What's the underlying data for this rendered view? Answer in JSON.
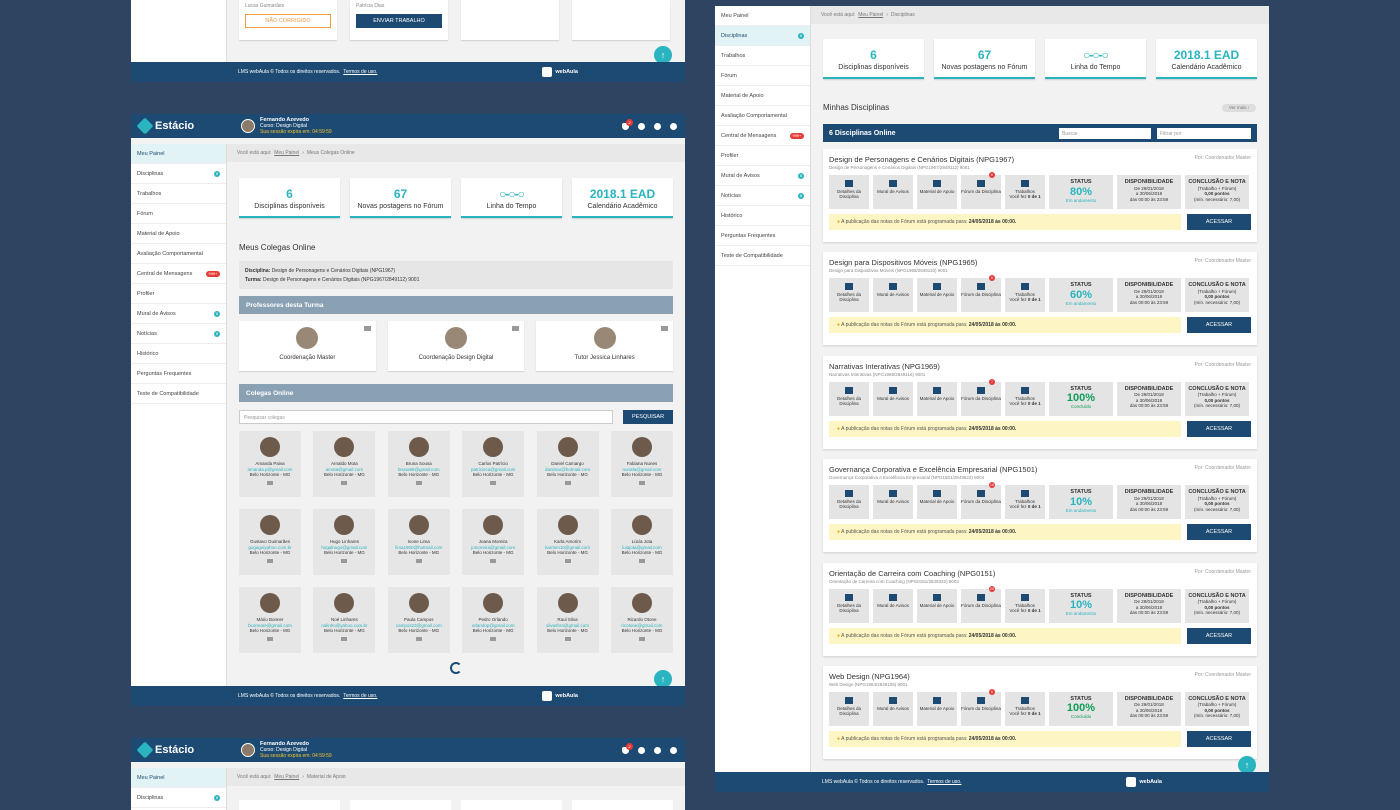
{
  "header": {
    "brand": "Estácio",
    "user_name": "Fernando Azevedo",
    "course": "Curso: Design Digital",
    "session": "Sua sessão expira em: 04:59:59",
    "notif_count": "2"
  },
  "sidebar": [
    {
      "label": "Meu Painel"
    },
    {
      "label": "Disciplinas",
      "badge": "6"
    },
    {
      "label": "Trabalhos"
    },
    {
      "label": "Fórum"
    },
    {
      "label": "Material de Apoio"
    },
    {
      "label": "Avaliação Comportamental"
    },
    {
      "label": "Central de Mensagens",
      "badge": "999+"
    },
    {
      "label": "Profiler"
    },
    {
      "label": "Mural de Avisos",
      "badge": "6"
    },
    {
      "label": "Notícias",
      "badge": "6"
    },
    {
      "label": "Histórico"
    },
    {
      "label": "Perguntas Frequentes"
    },
    {
      "label": "Teste de Compatibilidade"
    }
  ],
  "stats": [
    {
      "value": "6",
      "label": "Disciplinas disponíveis"
    },
    {
      "value": "67",
      "label": "Novas postagens no Fórum"
    },
    {
      "value": "",
      "label": "Linha do Tempo"
    },
    {
      "value": "2018.1 EAD",
      "label": "Calendário Acadêmico"
    }
  ],
  "footer": {
    "text": "LMS webAula © Todos os direitos reservados.",
    "terms": "Termos de uso.",
    "brand": "webAula"
  },
  "top_fragment": {
    "name1": "Lucas Guimarães",
    "name2": "Patrícia Dias",
    "btn1": "NÃO CORRIGIDO",
    "btn2": "ENVIAR TRABALHO"
  },
  "colegas_page": {
    "crumb_here": "Você está aqui:",
    "crumb_home": "Meu Painel",
    "crumb_current": "Meus Colegas Online",
    "title": "Meus Colegas Online",
    "disciplina_label": "Disciplina:",
    "disciplina": "Design de Personagens e Cenários Digitais (NPG1967)",
    "turma_label": "Turma:",
    "turma": "Design de Personagens e Cenários Digitais (NPG1967/2849112) 9001",
    "profs_title": "Professores desta Turma",
    "profs": [
      "Coordenação Master",
      "Coordenação Design Digital",
      "Tutor Jessica Linhares"
    ],
    "online_title": "Colegas Online",
    "search_placeholder": "Pesquisar colegas",
    "search_btn": "PESQUISAR",
    "colegas": [
      {
        "name": "Amanda Paiva",
        "email": "amanda.p@gmail.com",
        "city": "Belo Horizonte - MG"
      },
      {
        "name": "Arnaldo Mota",
        "email": "amota@gmail.com",
        "city": "Belo Horizonte - MG"
      },
      {
        "name": "Bruna Sousa",
        "email": "bruna88@gmail.com",
        "city": "Belo Horizonte - MG"
      },
      {
        "name": "Carlos Patrício",
        "email": "patricioca@gmail.com",
        "city": "Belo Horizonte - MG"
      },
      {
        "name": "Daniel Camargo",
        "email": "danimar@hotmail.com",
        "city": "Belo Horizonte - MG"
      },
      {
        "name": "Fabiana Nunes",
        "email": "nunafa@gmail.com",
        "city": "Belo Horizonte - MG"
      },
      {
        "name": "Gustavo Guimarães",
        "email": "gugaguiyahoo.com.br",
        "city": "Belo Horizonte - MG"
      },
      {
        "name": "Hugo Linhares",
        "email": "hugalnugo@gmail.com",
        "city": "Belo Horizonte - MG"
      },
      {
        "name": "Ivone Lima",
        "email": "lima1900@hotmail.com",
        "city": "Belo Horizonte - MG"
      },
      {
        "name": "Joana Moreira",
        "email": "jomoreira@gmail.com",
        "city": "Belo Horizonte - MG"
      },
      {
        "name": "Karla Amorim",
        "email": "karmim10@gmail.com",
        "city": "Belo Horizonte - MG"
      },
      {
        "name": "Lúcia Jota",
        "email": "luiajota@gmail.com",
        "city": "Belo Horizonte - MG"
      },
      {
        "name": "Mário Bonner",
        "email": "bconnare@gmail.com",
        "city": "Belo Horizonte - MG"
      },
      {
        "name": "Noé Linhares",
        "email": "nalinho@yahoo.com.br",
        "city": "Belo Horizonte - MG"
      },
      {
        "name": "Paula Campos",
        "email": "campos23@gmail.com",
        "city": "Belo Horizonte - MG"
      },
      {
        "name": "Pedro Orlando",
        "email": "orlandop@gmail.com",
        "city": "Belo Horizonte - MG"
      },
      {
        "name": "Raul Silva",
        "email": "silvashra@gmail.com",
        "city": "Belo Horizonte - MG"
      },
      {
        "name": "Ricardo Otone",
        "email": "ricotone@gmail.com",
        "city": "Belo Horizonte - MG"
      }
    ]
  },
  "material_page": {
    "crumb_here": "Você está aqui:",
    "crumb_home": "Meu Painel",
    "crumb_current": "Material de Apoio"
  },
  "disciplinas_page": {
    "crumb_here": "Você está aqui:",
    "crumb_home": "Meu Painel",
    "crumb_current": "Disciplinas",
    "title": "Minhas Disciplinas",
    "ver_mais": "Ver mais",
    "online_title": "6 Disciplinas Online",
    "buscar": "Buscar",
    "filtrar": "Filtrar por",
    "labels": {
      "detalhes": "Detalhes da Disciplina",
      "mural": "Mural de Avisos",
      "material": "Material de Apoio",
      "forum": "Fórum da Disciplina",
      "trabalhos": "Trabalhos",
      "voce_fez": "Você fez",
      "zero_de_um": "0 de 1",
      "status": "STATUS",
      "disponibilidade": "DISPONIBILIDADE",
      "de": "De 29/01/2018",
      "ate": "a 30/06/2018",
      "horas": "das 00:00 às 23:59",
      "conclusao": "CONCLUSÃO E NOTA",
      "trab_forum": "(Trabalho + Fórum)",
      "pontos": "0,00 pontos",
      "min": "(mín. necessário: 7,00)",
      "notice": "A publicação das notas do Fórum está programada para:",
      "notice_date": "24/05/2018 às 00:00.",
      "acessar": "ACESSAR",
      "por": "Por: Coordenador Master"
    },
    "disciplinas": [
      {
        "title": "Design de Personagens e Cenários Digitais (NPG1967)",
        "sub": "Design de Personagens e Cenários Digitais (NPG1967/2849112) 9001",
        "forum_badge": "6",
        "pct": "80%",
        "status": "Em andamento",
        "done": false
      },
      {
        "title": "Design para Dispositivos Móveis (NPG1965)",
        "sub": "Design para Dispositivos Móveis (NPG1965/2849110) 9001",
        "forum_badge": "6",
        "pct": "60%",
        "status": "Em andamento",
        "done": false
      },
      {
        "title": "Narrativas Interativas (NPG1969)",
        "sub": "Narrativas Interativas (NPG1969/2849116) 9001",
        "forum_badge": "7",
        "pct": "100%",
        "status": "Concluído",
        "done": true
      },
      {
        "title": "Governança Corporativa e Excelência Empresarial (NPG1501)",
        "sub": "Governança Corporativa e Excelência Empresarial (NPG1501/2849622) 9004",
        "forum_badge": "16",
        "pct": "10%",
        "status": "Em andamento",
        "done": false
      },
      {
        "title": "Orientação de Carreira com Coaching (NPG0151)",
        "sub": "Orientação de Carreira com Coaching (NPG0151/2849332) 9003",
        "forum_badge": "20",
        "pct": "10%",
        "status": "Em andamento",
        "done": false
      },
      {
        "title": "Web Design (NPG1964)",
        "sub": "Web Design (NPG1964/2849105) 9001",
        "forum_badge": "6",
        "pct": "100%",
        "status": "Concluído",
        "done": true
      }
    ]
  },
  "colors": {
    "primary": "#1d4a72",
    "accent": "#2ab4c0",
    "background": "#2f4460"
  }
}
